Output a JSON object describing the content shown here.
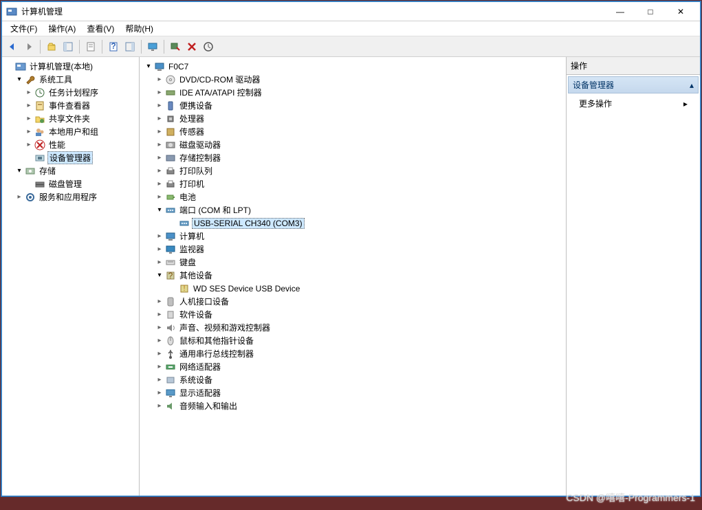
{
  "window": {
    "title": "计算机管理",
    "minimize": "—",
    "maximize": "□",
    "close": "✕"
  },
  "menubar": [
    "文件(F)",
    "操作(A)",
    "查看(V)",
    "帮助(H)"
  ],
  "left_tree": [
    {
      "indent": 0,
      "chev": "",
      "icon": "console-icon",
      "label": "计算机管理(本地)"
    },
    {
      "indent": 1,
      "chev": "open",
      "icon": "wrench-icon",
      "label": "系统工具"
    },
    {
      "indent": 2,
      "chev": "closed",
      "icon": "clock-icon",
      "label": "任务计划程序"
    },
    {
      "indent": 2,
      "chev": "closed",
      "icon": "event-icon",
      "label": "事件查看器"
    },
    {
      "indent": 2,
      "chev": "closed",
      "icon": "folder-share-icon",
      "label": "共享文件夹"
    },
    {
      "indent": 2,
      "chev": "closed",
      "icon": "users-icon",
      "label": "本地用户和组"
    },
    {
      "indent": 2,
      "chev": "closed",
      "icon": "perf-icon",
      "label": "性能"
    },
    {
      "indent": 2,
      "chev": "",
      "icon": "device-icon",
      "label": "设备管理器",
      "selected": true
    },
    {
      "indent": 1,
      "chev": "open",
      "icon": "storage-icon",
      "label": "存储"
    },
    {
      "indent": 2,
      "chev": "",
      "icon": "disk-icon",
      "label": "磁盘管理"
    },
    {
      "indent": 1,
      "chev": "closed",
      "icon": "services-icon",
      "label": "服务和应用程序"
    }
  ],
  "mid_tree": [
    {
      "indent": 0,
      "chev": "open",
      "icon": "computer-icon",
      "label": "F0C7"
    },
    {
      "indent": 1,
      "chev": "closed",
      "icon": "dvd-icon",
      "label": "DVD/CD-ROM 驱动器"
    },
    {
      "indent": 1,
      "chev": "closed",
      "icon": "ide-icon",
      "label": "IDE ATA/ATAPI 控制器"
    },
    {
      "indent": 1,
      "chev": "closed",
      "icon": "portable-icon",
      "label": "便携设备"
    },
    {
      "indent": 1,
      "chev": "closed",
      "icon": "cpu-icon",
      "label": "处理器"
    },
    {
      "indent": 1,
      "chev": "closed",
      "icon": "sensor-icon",
      "label": "传感器"
    },
    {
      "indent": 1,
      "chev": "closed",
      "icon": "diskdrive-icon",
      "label": "磁盘驱动器"
    },
    {
      "indent": 1,
      "chev": "closed",
      "icon": "storagectrl-icon",
      "label": "存储控制器"
    },
    {
      "indent": 1,
      "chev": "closed",
      "icon": "printer-icon",
      "label": "打印队列"
    },
    {
      "indent": 1,
      "chev": "closed",
      "icon": "printer-icon",
      "label": "打印机"
    },
    {
      "indent": 1,
      "chev": "closed",
      "icon": "battery-icon",
      "label": "电池"
    },
    {
      "indent": 1,
      "chev": "open",
      "icon": "port-icon",
      "label": "端口 (COM 和 LPT)"
    },
    {
      "indent": 2,
      "chev": "",
      "icon": "port-icon",
      "label": "USB-SERIAL CH340 (COM3)",
      "selected": true
    },
    {
      "indent": 1,
      "chev": "closed",
      "icon": "computer-icon",
      "label": "计算机"
    },
    {
      "indent": 1,
      "chev": "closed",
      "icon": "monitor-icon",
      "label": "监视器"
    },
    {
      "indent": 1,
      "chev": "closed",
      "icon": "keyboard-icon",
      "label": "键盘"
    },
    {
      "indent": 1,
      "chev": "open",
      "icon": "other-icon",
      "label": "其他设备"
    },
    {
      "indent": 2,
      "chev": "",
      "icon": "unknown-icon",
      "label": "WD SES Device USB Device"
    },
    {
      "indent": 1,
      "chev": "closed",
      "icon": "hid-icon",
      "label": "人机接口设备"
    },
    {
      "indent": 1,
      "chev": "closed",
      "icon": "software-icon",
      "label": "软件设备"
    },
    {
      "indent": 1,
      "chev": "closed",
      "icon": "audio-icon",
      "label": "声音、视频和游戏控制器"
    },
    {
      "indent": 1,
      "chev": "closed",
      "icon": "mouse-icon",
      "label": "鼠标和其他指针设备"
    },
    {
      "indent": 1,
      "chev": "closed",
      "icon": "usb-icon",
      "label": "通用串行总线控制器"
    },
    {
      "indent": 1,
      "chev": "closed",
      "icon": "network-icon",
      "label": "网络适配器"
    },
    {
      "indent": 1,
      "chev": "closed",
      "icon": "system-icon",
      "label": "系统设备"
    },
    {
      "indent": 1,
      "chev": "closed",
      "icon": "display-icon",
      "label": "显示适配器"
    },
    {
      "indent": 1,
      "chev": "closed",
      "icon": "audioio-icon",
      "label": "音频输入和输出"
    }
  ],
  "right": {
    "header": "操作",
    "section": "设备管理器",
    "more": "更多操作"
  },
  "watermark": "CSDN @嘻嘻-Programmers-1"
}
